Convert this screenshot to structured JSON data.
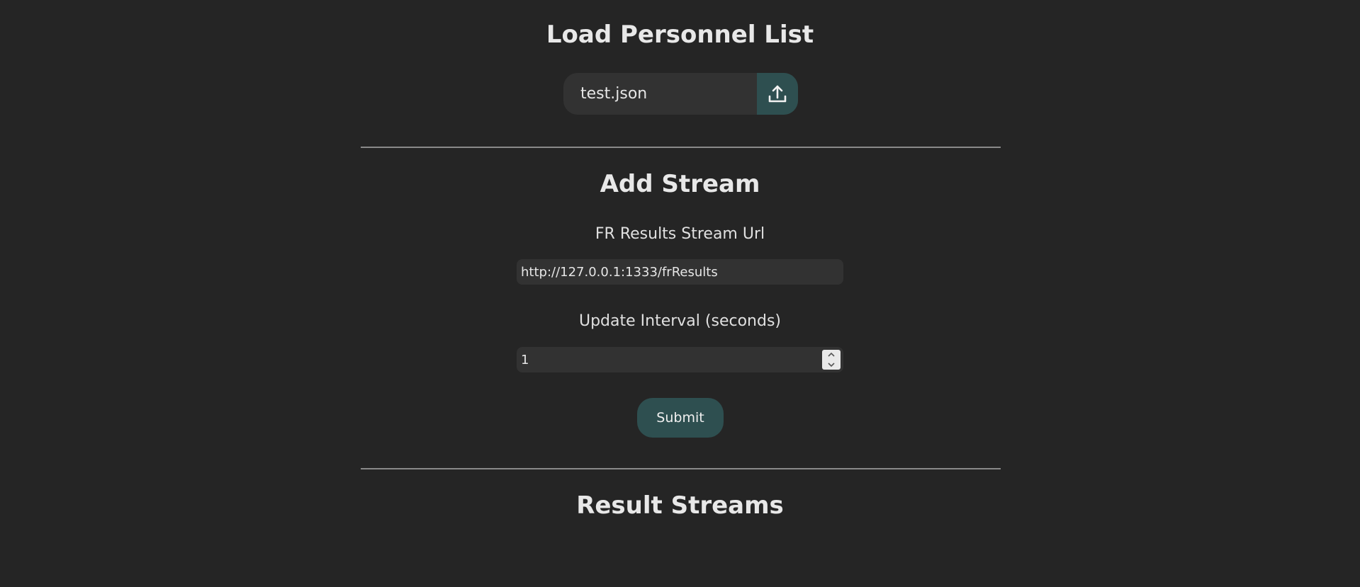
{
  "load_section": {
    "title": "Load Personnel List",
    "file_name": "test.json",
    "upload_icon": "upload-icon"
  },
  "add_stream_section": {
    "title": "Add Stream",
    "url_label": "FR Results Stream Url",
    "url_value": "http://127.0.0.1:1333/frResults",
    "interval_label": "Update Interval (seconds)",
    "interval_value": "1",
    "submit_label": "Submit"
  },
  "result_streams_section": {
    "title": "Result Streams"
  },
  "colors": {
    "background": "#252525",
    "accent": "#2e4f50",
    "field": "#323232",
    "text": "#e8e8e8",
    "divider": "#8a8a8a"
  }
}
